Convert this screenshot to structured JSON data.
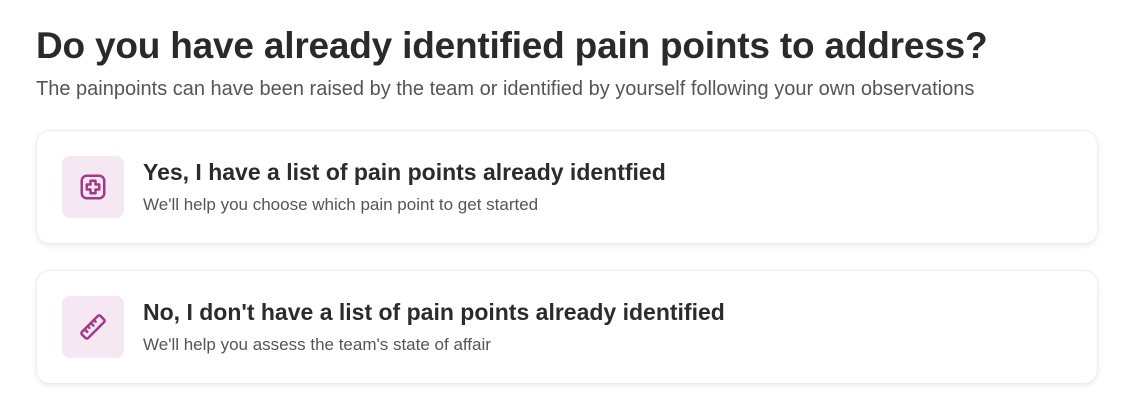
{
  "question": {
    "title": "Do you have already identified pain points to address?",
    "subtitle": "The painpoints can have been raised by the team or identified by yourself following your own observations"
  },
  "options": [
    {
      "title": "Yes, I have a list of pain points already identfied",
      "description": "We'll help you choose which pain point to get started",
      "icon": "medical-cross-icon"
    },
    {
      "title": "No, I don't have a list of pain points already identified",
      "description": "We'll help you assess the team's state of affair",
      "icon": "ruler-icon"
    }
  ],
  "colors": {
    "accent": "#a23a8a",
    "icon_background": "#f6e8f3"
  }
}
